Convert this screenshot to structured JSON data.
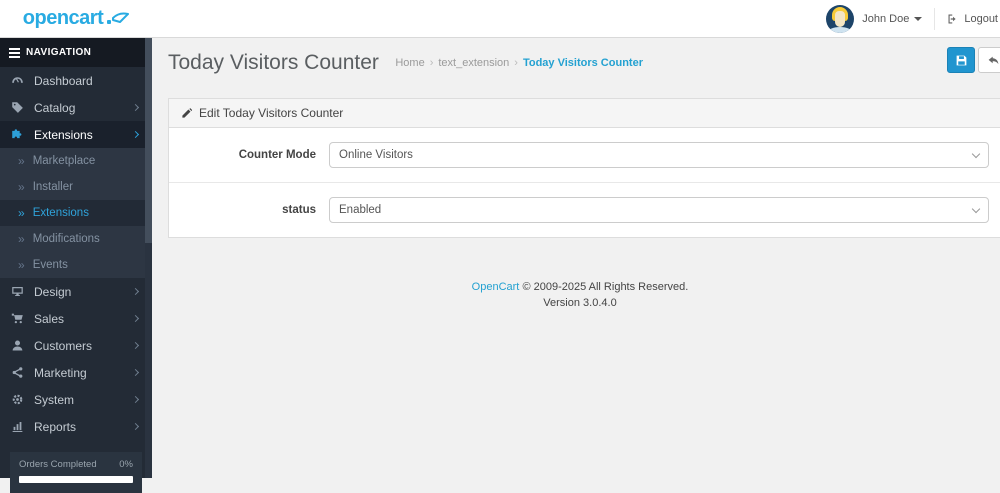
{
  "brand": {
    "name": "opencart"
  },
  "header": {
    "user": "John Doe",
    "logout": "Logout"
  },
  "sidebar": {
    "title": "NAVIGATION",
    "items": [
      {
        "label": "Dashboard"
      },
      {
        "label": "Catalog"
      },
      {
        "label": "Extensions"
      },
      {
        "label": "Design"
      },
      {
        "label": "Sales"
      },
      {
        "label": "Customers"
      },
      {
        "label": "Marketing"
      },
      {
        "label": "System"
      },
      {
        "label": "Reports"
      }
    ],
    "sub": [
      {
        "label": "Marketplace"
      },
      {
        "label": "Installer"
      },
      {
        "label": "Extensions"
      },
      {
        "label": "Modifications"
      },
      {
        "label": "Events"
      }
    ],
    "stats": {
      "label": "Orders Completed",
      "value": "0%"
    }
  },
  "page": {
    "title": "Today Visitors Counter",
    "crumbs": [
      "Home",
      "text_extension",
      "Today Visitors Counter"
    ]
  },
  "panel": {
    "title": "Edit Today Visitors Counter"
  },
  "form": {
    "rows": [
      {
        "label": "Counter Mode",
        "value": "Online Visitors"
      },
      {
        "label": "status",
        "value": "Enabled"
      }
    ]
  },
  "footer": {
    "brand": "OpenCart",
    "copyright": "© 2009-2025 All Rights Reserved.",
    "version": "Version 3.0.4.0"
  },
  "colors": {
    "accent": "#23a1d1",
    "save_button": "#2095cf",
    "sidebar_bg": "#232b36",
    "brand_blue": "#29abe2"
  }
}
